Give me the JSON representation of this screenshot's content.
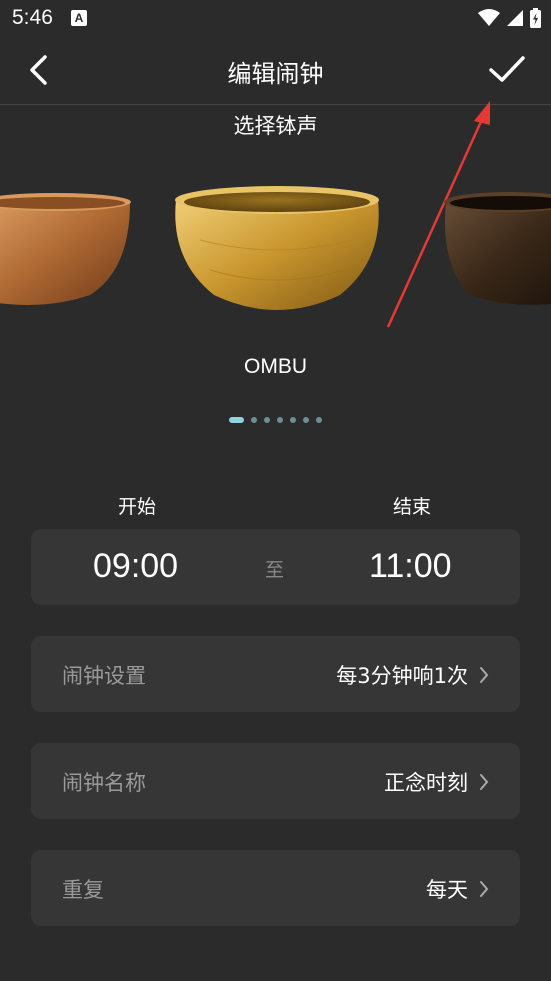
{
  "status": {
    "time": "5:46",
    "notif_icon_letter": "A"
  },
  "header": {
    "title": "编辑闹钟"
  },
  "sound_picker": {
    "title": "选择钵声",
    "selected_name": "OMBU",
    "page_count": 7,
    "active_page": 0
  },
  "time_range": {
    "start_label": "开始",
    "end_label": "结束",
    "start": "09:00",
    "separator": "至",
    "end": "11:00"
  },
  "settings": {
    "alarm_setting_label": "闹钟设置",
    "alarm_setting_value": "每3分钟响1次",
    "alarm_name_label": "闹钟名称",
    "alarm_name_value": "正念时刻",
    "repeat_label": "重复",
    "repeat_value": "每天"
  },
  "colors": {
    "background": "#2b2b2b",
    "card": "#363636",
    "accent": "#8fd3e0",
    "annotation_arrow": "#e53935"
  }
}
